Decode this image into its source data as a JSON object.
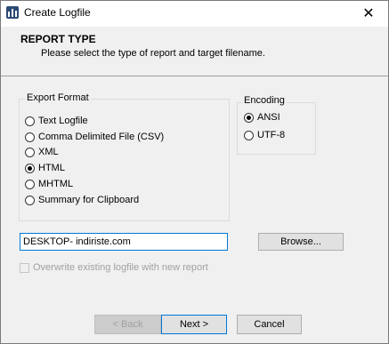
{
  "window": {
    "title": "Create Logfile",
    "close_glyph": "✕"
  },
  "header": {
    "title": "REPORT TYPE",
    "subtitle": "Please select the type of report and target filename."
  },
  "export_format": {
    "legend": "Export Format",
    "options": [
      {
        "label": "Text Logfile",
        "checked": false
      },
      {
        "label": "Comma Delimited File (CSV)",
        "checked": false
      },
      {
        "label": "XML",
        "checked": false
      },
      {
        "label": "HTML",
        "checked": true
      },
      {
        "label": "MHTML",
        "checked": false
      },
      {
        "label": "Summary for Clipboard",
        "checked": false
      }
    ]
  },
  "encoding": {
    "legend": "Encoding",
    "options": [
      {
        "label": "ANSI",
        "checked": true
      },
      {
        "label": "UTF-8",
        "checked": false
      }
    ]
  },
  "filename": {
    "value": "DESKTOP- indiriste.com"
  },
  "browse_button": "Browse...",
  "overwrite_checkbox": {
    "label": "Overwrite existing logfile with new report",
    "checked": false,
    "enabled": false
  },
  "footer": {
    "back": "< Back",
    "next": "Next >",
    "cancel": "Cancel"
  }
}
